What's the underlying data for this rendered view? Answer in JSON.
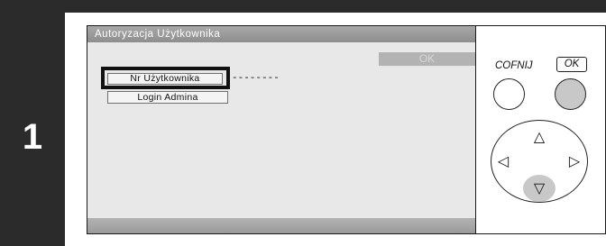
{
  "step": {
    "number": "1"
  },
  "screen": {
    "title": "Autoryzacja Użytkownika",
    "ok_label": "OK",
    "buttons": {
      "user_number": "Nr Użytkownika",
      "user_number_value": "--------",
      "admin_login": "Login Admina"
    }
  },
  "keypad": {
    "back_label": "COFNIJ",
    "ok_label": "OK",
    "arrows": {
      "up": "△",
      "down": "▽",
      "left": "◁",
      "right": "▷"
    }
  },
  "colors": {
    "step_bar": "#2b2b2b",
    "screen_bg": "#e8e8e8",
    "title_bar": "#9a9a9a",
    "highlight_button": "#c8c8c8"
  }
}
